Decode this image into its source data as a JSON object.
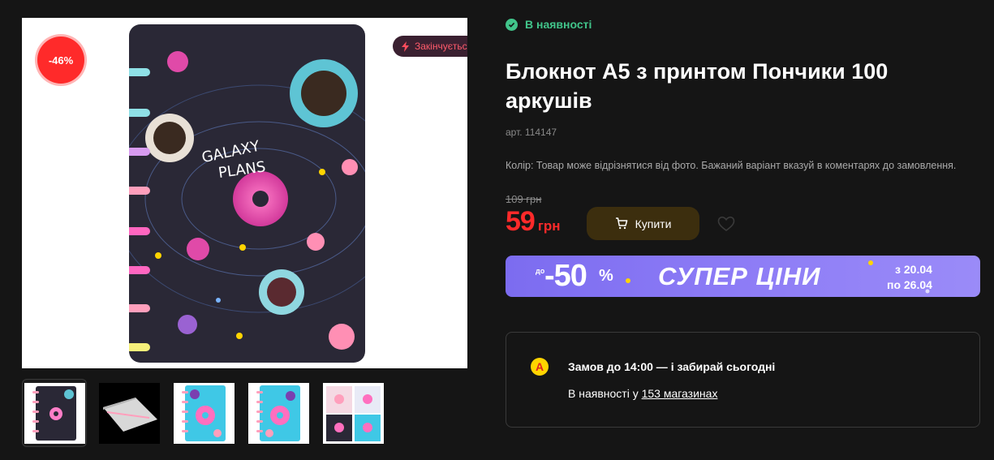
{
  "gallery": {
    "discount_badge": "-46%",
    "ending_badge": "Закінчується",
    "cover_text": [
      "GALAXY",
      "PLANS"
    ],
    "thumbnails": [
      "thumb-1",
      "thumb-2",
      "thumb-3",
      "thumb-4",
      "thumb-5"
    ]
  },
  "product": {
    "availability": "В наявності",
    "title": "Блокнот А5 з принтом Пончики 100 аркушів",
    "sku": "арт. 114147",
    "color_note": "Колір: Товар може відрізнятися від фото. Бажаний варіант вказуй в коментарях до замовлення.",
    "old_price": "109 грн",
    "price_value": "59",
    "price_currency": "грн",
    "buy_label": "Купити"
  },
  "promo": {
    "prefix": "до",
    "percent": "-50",
    "percent_sign": "%",
    "title": "СУПЕР ЦІНИ",
    "date_from": "з 20.04",
    "date_to": "по 26.04"
  },
  "pickup": {
    "logo_letter": "А",
    "headline": "Замов до 14:00 — і забирай сьогодні",
    "stock_prefix": "В наявності у ",
    "stock_link": "153 магазинах"
  },
  "colors": {
    "background": "#151515",
    "accent_red": "#ff2a2a",
    "stock_green": "#41c48a",
    "promo_purple": "#8d7cf6"
  }
}
